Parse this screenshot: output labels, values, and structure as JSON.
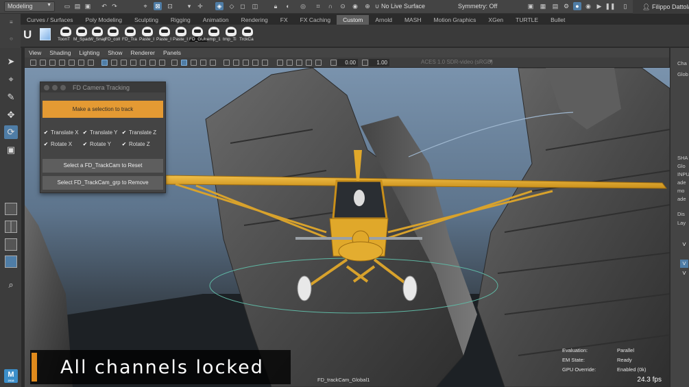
{
  "statusline": {
    "mode": "Modeling",
    "live_surface": "No Live Surface",
    "symmetry": "Symmetry: Off",
    "user": "Filippo Dattola"
  },
  "shelf": {
    "tabs": [
      "Curves / Surfaces",
      "Poly Modeling",
      "Sculpting",
      "Rigging",
      "Animation",
      "Rendering",
      "FX",
      "FX Caching",
      "Custom",
      "Arnold",
      "MASH",
      "Motion Graphics",
      "XGen",
      "TURTLE",
      "Bullet"
    ],
    "active_tab": "Custom",
    "icons": [
      "ToonT",
      "M_Spac",
      "W_Snap",
      "FD_coll",
      "FD_Tra",
      "Paste_I",
      "Paste_I",
      "Paste_I",
      "FD_GUI",
      "temp_1",
      "tmp_Ti",
      "TrckCa"
    ]
  },
  "panel": {
    "menu": [
      "View",
      "Shading",
      "Lighting",
      "Show",
      "Renderer",
      "Panels"
    ],
    "near_value": "0.00",
    "far_value": "1.00",
    "colorspace": "ACES 1.0 SDR-video (sRGB)"
  },
  "fd_window": {
    "title": "FD Camera Tracking",
    "track_button": "Make a selection to track",
    "checks": {
      "tx": "Translate X",
      "ty": "Translate Y",
      "tz": "Translate Z",
      "rx": "Rotate X",
      "ry": "Rotate Y",
      "rz": "Rotate Z"
    },
    "reset_button": "Select a FD_TrackCam to Reset",
    "remove_button": "Select FD_TrackCam_grp to Remove"
  },
  "viewport": {
    "caption": "All channels locked",
    "camera_name": "FD_trackCam_Global1",
    "hud": [
      {
        "key": "Evaluation:",
        "value": "Parallel"
      },
      {
        "key": "EM State:",
        "value": "Ready"
      },
      {
        "key": "GPU Override:",
        "value": "Enabled (0k)"
      }
    ],
    "fps": "24.3 fps"
  },
  "channel_box": {
    "lines": [
      "Cha",
      "Glob",
      "SHA",
      "Glo",
      "INPU",
      "ade",
      "mo",
      "ade",
      "Dis",
      "Lay"
    ],
    "vis": [
      "V",
      "V",
      "V"
    ]
  },
  "colors": {
    "accent": "#e49a33",
    "selection": "#4f7da6",
    "caption_bar": "#e08a1c",
    "plane": "#e0a82a"
  },
  "icons": [
    "select-icon",
    "lasso-icon",
    "paint-select-icon",
    "move-icon",
    "rotate-icon",
    "scale-icon",
    "search-icon",
    "maya-logo-icon"
  ]
}
